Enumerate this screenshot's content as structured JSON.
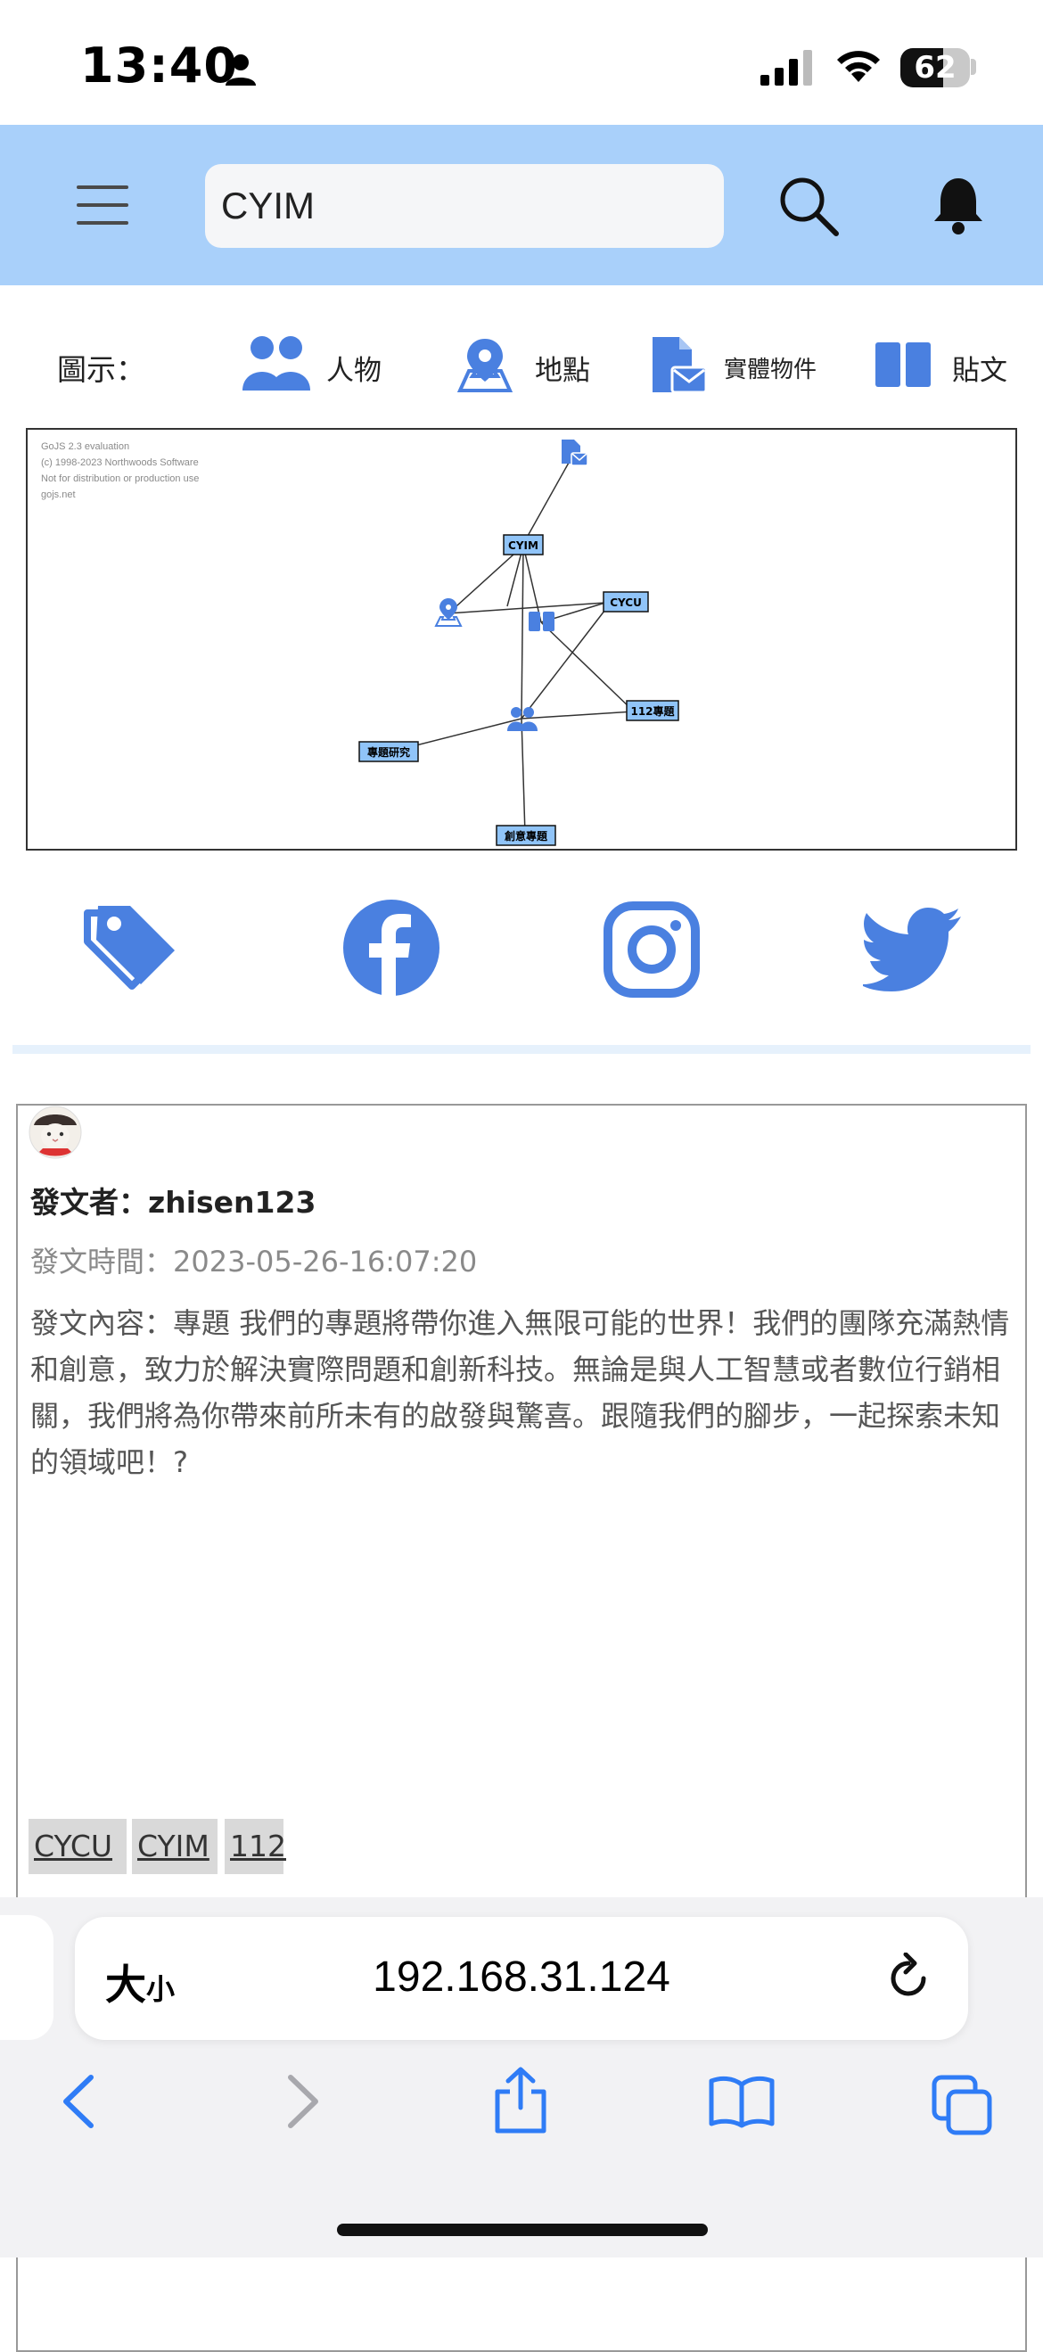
{
  "status_bar": {
    "time": "13:40",
    "battery": "62"
  },
  "header": {
    "search_value": "CYIM"
  },
  "legend": {
    "title": "圖示：",
    "items": [
      {
        "label": "人物",
        "icon": "people-icon"
      },
      {
        "label": "地點",
        "icon": "location-icon"
      },
      {
        "label": "實體物件",
        "icon": "file-envelope-icon"
      },
      {
        "label": "貼文",
        "icon": "book-icon"
      }
    ]
  },
  "diagram": {
    "notice": [
      "GoJS 2.3 evaluation",
      "(c) 1998-2023 Northwoods Software",
      "Not for distribution or production use",
      "gojs.net"
    ],
    "nodes": {
      "cyim": "CYIM",
      "cycu": "CYCU",
      "n112": "112專題",
      "research": "專題研究",
      "creative": "創意專題"
    }
  },
  "social": [
    "tag-icon",
    "facebook-icon",
    "instagram-icon",
    "twitter-icon"
  ],
  "post": {
    "author_label": "發文者：",
    "author": "zhisen123",
    "time_label": "發文時間：",
    "time": "2023-05-26-16:07:20",
    "content_label": "發文內容：",
    "content": "專題 我們的專題將帶你進入無限可能的世界！我們的團隊充滿熱情和創意，致力於解決實際問題和創新科技。無論是與人工智慧或者數位行銷相關，我們將為你帶來前所未有的啟發與驚喜。跟隨我們的腳步，一起探索未知的領域吧！?",
    "tags": [
      "CYCU",
      "CYIM",
      "112"
    ]
  },
  "browser": {
    "text_size_big": "大",
    "text_size_small": "小",
    "url": "192.168.31.124"
  },
  "colors": {
    "header_bg": "#a9d0fa",
    "icon_blue": "#4a80e0",
    "node_fill": "#90c4f8"
  }
}
